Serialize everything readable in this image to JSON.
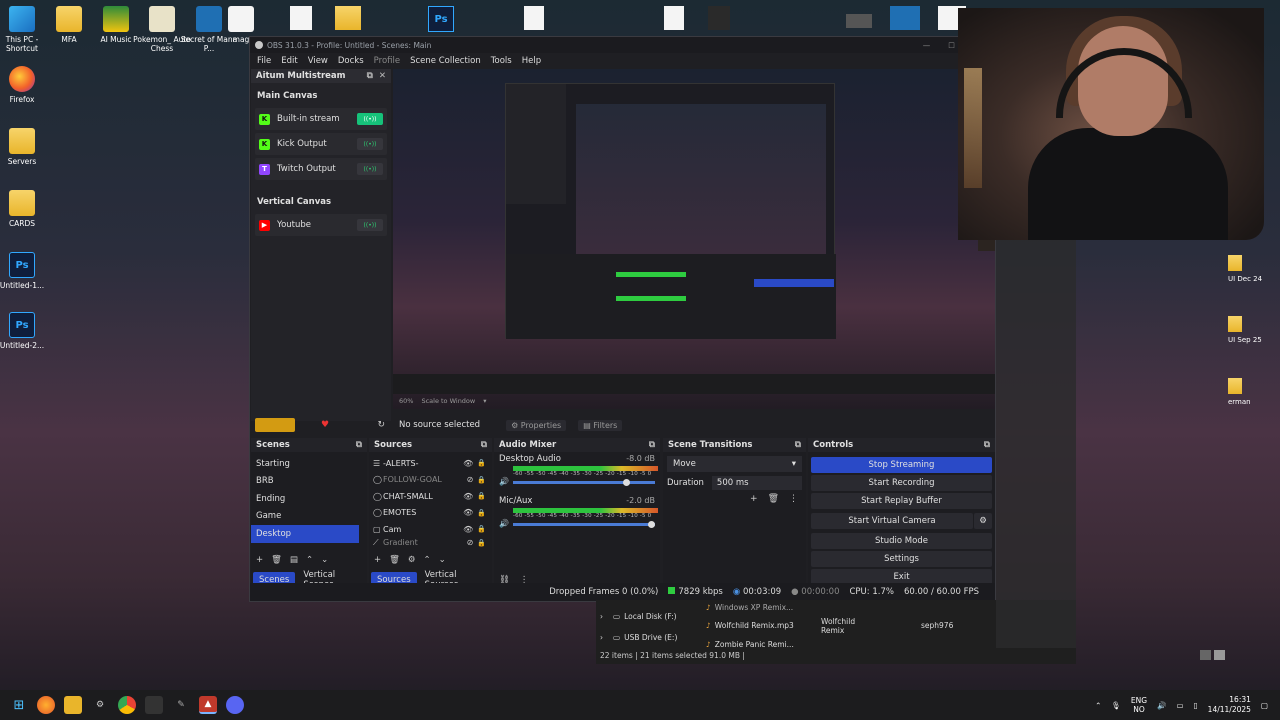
{
  "desktop": {
    "left_icons": [
      {
        "label": "This PC - Shortcut",
        "icon": "pc-icon"
      },
      {
        "label": "Firefox",
        "icon": "firefox-icon"
      },
      {
        "label": "Servers",
        "icon": "folder-icon"
      },
      {
        "label": "CARDS",
        "icon": "folder-icon"
      },
      {
        "label": "Untitled-1...",
        "icon": "photoshop-file-icon"
      },
      {
        "label": "Untitled-2...",
        "icon": "photoshop-file-icon"
      }
    ],
    "top_icons": [
      {
        "label": "MFA",
        "icon": "folder-icon"
      },
      {
        "label": "AI Music",
        "icon": "green-folder-icon"
      },
      {
        "label": "Pokemon_ Auto Chess",
        "icon": "pokemon-icon"
      },
      {
        "label": "Secret of Mana P...",
        "icon": "app-icon"
      },
      {
        "label": "mag",
        "icon": "doc-icon"
      }
    ],
    "right_labels": [
      "UI Dec 24",
      "UI Sep 25",
      "erman"
    ]
  },
  "obs": {
    "title": "OBS 31.0.3 - Profile: Untitled - Scenes: Main",
    "menu": [
      "File",
      "Edit",
      "View",
      "Docks",
      "Profile",
      "Scene Collection",
      "Tools",
      "Help"
    ],
    "multistream": {
      "title": "Aitum Multistream",
      "main_canvas_label": "Main Canvas",
      "main_outputs": [
        {
          "name": "Built-in stream",
          "active": true,
          "color": "#53fc18"
        },
        {
          "name": "Kick Output",
          "active": false,
          "color": "#53fc18"
        },
        {
          "name": "Twitch Output",
          "active": false,
          "color": "#9146ff"
        }
      ],
      "vertical_canvas_label": "Vertical Canvas",
      "vertical_outputs": [
        {
          "name": "Youtube",
          "active": false,
          "color": "#ff0000"
        }
      ]
    },
    "preview_zoom": "60%",
    "preview_mode": "Scale to Window",
    "no_source": "No source selected",
    "properties_label": "Properties",
    "filters_label": "Filters",
    "scenes": {
      "title": "Scenes",
      "items": [
        "Starting",
        "BRB",
        "Ending",
        "Game",
        "Desktop"
      ],
      "selected": "Desktop",
      "tabs": [
        "Scenes",
        "Vertical Scenes"
      ]
    },
    "sources": {
      "title": "Sources",
      "items": [
        {
          "name": "-ALERTS-",
          "dim": false
        },
        {
          "name": "FOLLOW-GOAL",
          "dim": true
        },
        {
          "name": "CHAT-SMALL",
          "dim": false
        },
        {
          "name": "EMOTES",
          "dim": false
        },
        {
          "name": "Cam",
          "dim": false
        },
        {
          "name": "Gradient",
          "dim": true
        }
      ],
      "tabs": [
        "Sources",
        "Vertical Sources"
      ]
    },
    "mixer": {
      "title": "Audio Mixer",
      "channels": [
        {
          "name": "Desktop Audio",
          "db": "-8.0 dB"
        },
        {
          "name": "Mic/Aux",
          "db": "-2.0 dB"
        }
      ],
      "ticks": "-60 -55 -50 -45 -40 -35 -30 -25 -20 -15 -10 -5 0"
    },
    "transitions": {
      "title": "Scene Transitions",
      "selected": "Move",
      "duration_label": "Duration",
      "duration_value": "500 ms"
    },
    "controls": {
      "title": "Controls",
      "buttons": [
        "Stop Streaming",
        "Start Recording",
        "Start Replay Buffer",
        "Start Virtual Camera",
        "Studio Mode",
        "Settings",
        "Exit"
      ]
    },
    "status": {
      "dropped": "Dropped Frames 0 (0.0%)",
      "bitrate": "7829 kbps",
      "stream_time": "00:03:09",
      "rec_time": "00:00:00",
      "cpu": "CPU: 1.7%",
      "fps": "60.00 / 60.00 FPS"
    }
  },
  "explorer": {
    "drives": [
      "Local Disk (F:)",
      "USB Drive (E:)"
    ],
    "files": [
      {
        "name": "Windows XP Remix...",
        "title": "",
        "artist": ""
      },
      {
        "name": "Wolfchild Remix.mp3",
        "title": "Wolfchild Remix",
        "artist": "seph976"
      },
      {
        "name": "Zombie Panic Remi...",
        "title": "",
        "artist": ""
      }
    ],
    "status": "22 items  |  21 items selected  91.0 MB  |"
  },
  "taskbar": {
    "lang_top": "ENG",
    "lang_bottom": "NO",
    "time": "16:31",
    "date": "14/11/2025"
  }
}
